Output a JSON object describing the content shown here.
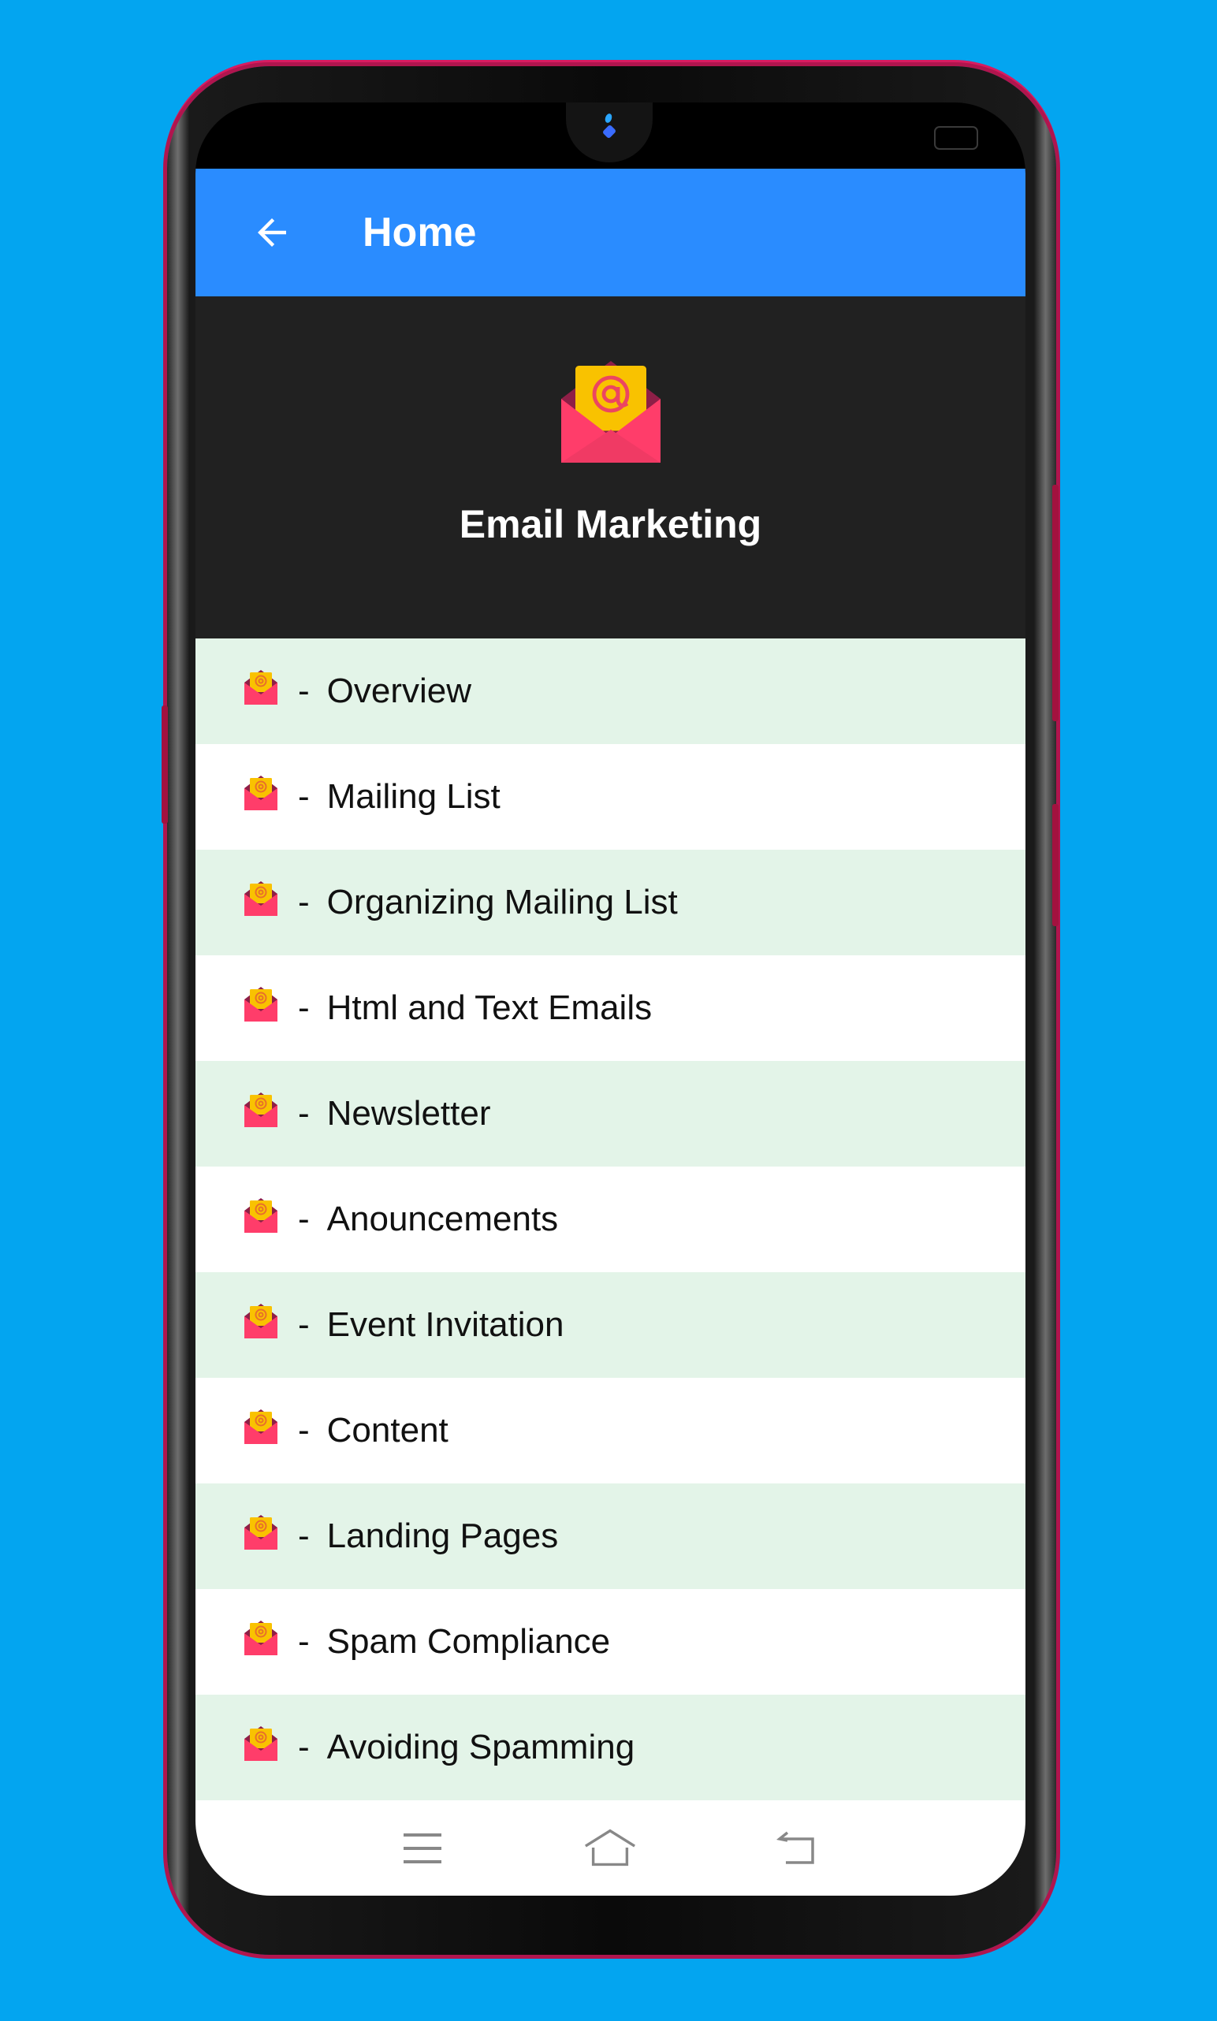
{
  "app_bar": {
    "title": "Home",
    "back_icon": "arrow-left-icon",
    "color": "#2a8cff"
  },
  "header": {
    "title": "Email Marketing",
    "icon": "open-envelope-at-icon",
    "background": "#212121"
  },
  "list": {
    "separator": "-",
    "row_colors": [
      "#e3f4e8",
      "#ffffff"
    ],
    "items": [
      {
        "label": "Overview"
      },
      {
        "label": "Mailing List"
      },
      {
        "label": "Organizing Mailing List"
      },
      {
        "label": "Html and Text Emails"
      },
      {
        "label": "Newsletter"
      },
      {
        "label": "Anouncements"
      },
      {
        "label": "Event Invitation"
      },
      {
        "label": "Content"
      },
      {
        "label": "Landing Pages"
      },
      {
        "label": "Spam Compliance"
      },
      {
        "label": "Avoiding Spamming"
      }
    ]
  },
  "system_nav": {
    "buttons": [
      {
        "name": "menu",
        "icon": "menu-lines-icon"
      },
      {
        "name": "home",
        "icon": "home-icon"
      },
      {
        "name": "back",
        "icon": "back-return-icon"
      }
    ]
  },
  "background_color": "#03a5f0"
}
